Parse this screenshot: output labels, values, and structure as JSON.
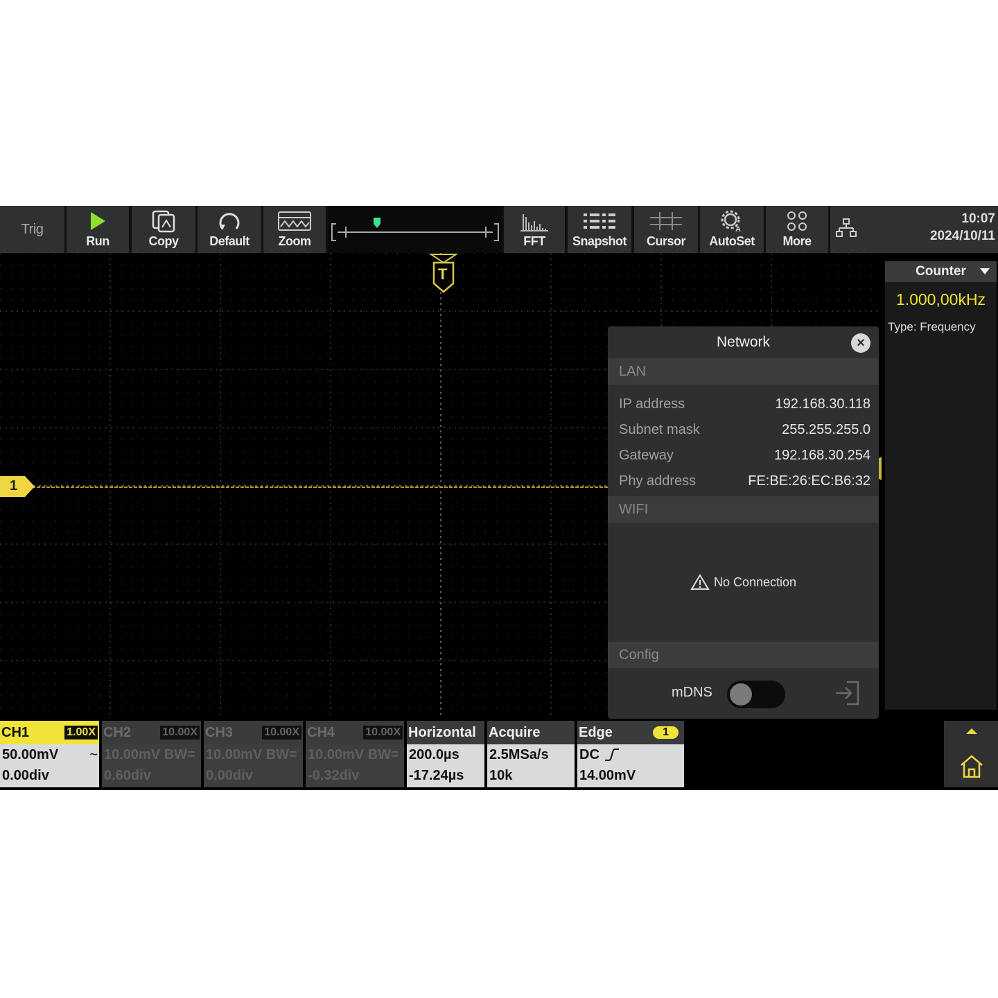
{
  "toolbar": {
    "trig": "Trig",
    "run": "Run",
    "copy": "Copy",
    "default": "Default",
    "zoom": "Zoom",
    "fft": "FFT",
    "snapshot": "Snapshot",
    "cursor": "Cursor",
    "autoset": "AutoSet",
    "more": "More",
    "time": "10:07",
    "date": "2024/10/11"
  },
  "markers": {
    "trigger": "T",
    "ch1": "1"
  },
  "counter": {
    "title": "Counter",
    "value": "1.000,00kHz",
    "type": "Type: Frequency"
  },
  "network": {
    "title": "Network",
    "lan_label": "LAN",
    "rows": [
      {
        "key": "IP address",
        "value": "192.168.30.118"
      },
      {
        "key": "Subnet mask",
        "value": "255.255.255.0"
      },
      {
        "key": "Gateway",
        "value": "192.168.30.254"
      },
      {
        "key": "Phy address",
        "value": "FE:BE:26:EC:B6:32"
      }
    ],
    "wifi_label": "WIFI",
    "wifi_status": "No Connection",
    "config_label": "Config",
    "mdns_label": "mDNS",
    "mdns_enabled": false
  },
  "channels": [
    {
      "name": "CH1",
      "probe": "1.00X",
      "scale": "50.00mV",
      "coupling": "~",
      "offset": "0.00div"
    },
    {
      "name": "CH2",
      "probe": "10.00X",
      "scale": "10.00mV",
      "coupling": "BW=",
      "offset": "0.60div"
    },
    {
      "name": "CH3",
      "probe": "10.00X",
      "scale": "10.00mV",
      "coupling": "BW=",
      "offset": "0.00div"
    },
    {
      "name": "CH4",
      "probe": "10.00X",
      "scale": "10.00mV",
      "coupling": "BW=",
      "offset": "-0.32div"
    }
  ],
  "horizontal": {
    "title": "Horizontal",
    "timebase": "200.0µs",
    "position": "-17.24µs"
  },
  "acquire": {
    "title": "Acquire",
    "rate": "2.5MSa/s",
    "depth": "10k"
  },
  "edge": {
    "title": "Edge",
    "source": "1",
    "coupling": "DC",
    "level": "14.00mV"
  },
  "colors": {
    "ch1": "#f0e33a",
    "toolbar_bg": "#2f3031",
    "run_green": "#8de02a"
  }
}
